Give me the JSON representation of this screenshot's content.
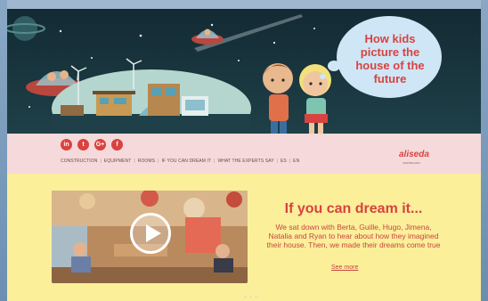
{
  "hero": {
    "bubble_title": "How kids picture the house of the future"
  },
  "nav": {
    "social_icons": [
      "linkedin-icon",
      "twitter-icon",
      "googleplus-icon",
      "facebook-icon"
    ],
    "social_glyphs": [
      "in",
      "t",
      "G+",
      "f"
    ],
    "menu_items": [
      "CONSTRUCTION",
      "EQUIPMENT",
      "ROOMS",
      "IF YOU CAN DREAM IT",
      "WHAT THE EXPERTS SAY",
      "ES",
      "EN"
    ],
    "logo": "aliseda",
    "logo_sub": "INMOBILIARIA"
  },
  "section": {
    "headline": "If you can dream it...",
    "body": "We sat down with Berta, Guille, Hugo, Jimena, Natalia and Ryan to hear about how they imagined their house. Then, we made their dreams come true",
    "see_more": "See more"
  },
  "colors": {
    "accent": "#d8433f",
    "hero_bg": "#17303a",
    "nav_bg": "#f6d9db",
    "content_bg": "#fbef9a",
    "bubble_bg": "#cfe6f6"
  }
}
